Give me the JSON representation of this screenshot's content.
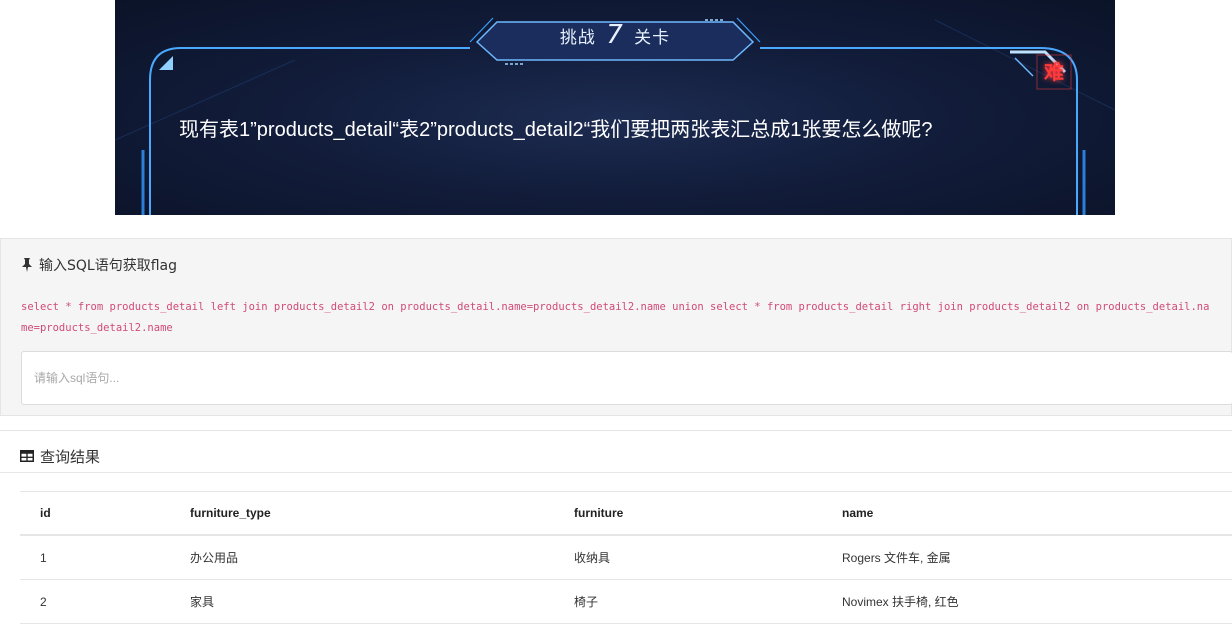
{
  "challenge": {
    "title_prefix": "挑战",
    "level_number": "7",
    "title_suffix": "关卡",
    "difficulty": "难",
    "question": "现有表1”products_detail“表2”products_detail2“我们要把两张表汇总成1张要怎么做呢?"
  },
  "sql_panel": {
    "heading": "输入SQL语句获取flag",
    "hint": "select * from products_detail left join products_detail2 on products_detail.name=products_detail2.name union select * from products_detail right join products_detail2 on products_detail.name=products_detail2.name",
    "input_value": "",
    "input_placeholder": "请输入sql语句..."
  },
  "results": {
    "heading": "查询结果",
    "columns": [
      "id",
      "furniture_type",
      "furniture",
      "name"
    ],
    "rows": [
      [
        "1",
        "办公用品",
        "收纳具",
        "Rogers 文件车, 金属"
      ],
      [
        "2",
        "家具",
        "椅子",
        "Novimex 扶手椅, 红色"
      ]
    ]
  },
  "colors": {
    "banner_bg": "#121d3b",
    "frame_glow": "#3aa0ff",
    "difficulty_red": "#ff3b3b",
    "sql_hint": "#d14a78"
  }
}
